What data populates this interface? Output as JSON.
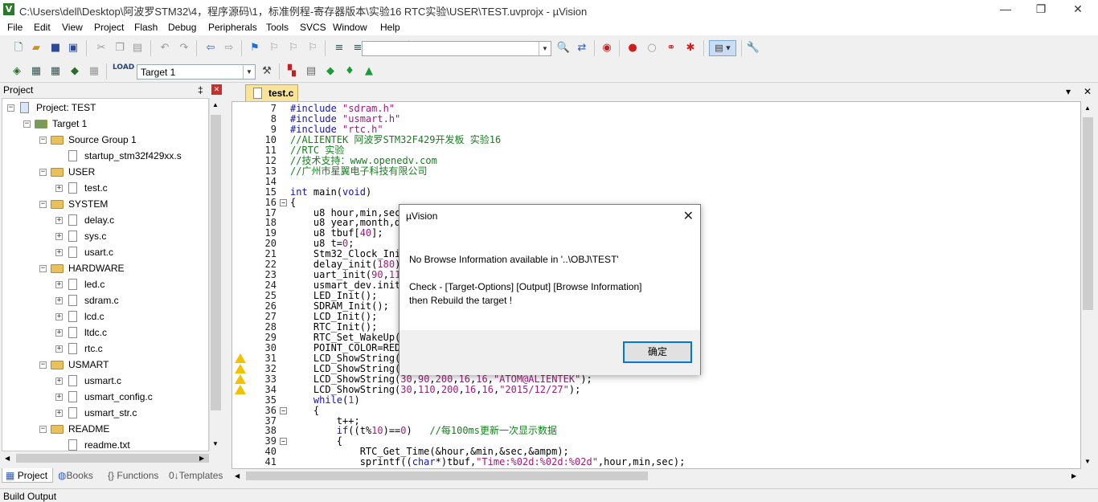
{
  "window": {
    "title": "C:\\Users\\dell\\Desktop\\阿波罗STM32\\4，程序源码\\1，标准例程-寄存器版本\\实验16 RTC实验\\USER\\TEST.uvprojx - µVision",
    "logo": "V",
    "minimize": "—",
    "maximize": "❐",
    "close": "✕"
  },
  "menu": [
    "File",
    "Edit",
    "View",
    "Project",
    "Flash",
    "Debug",
    "Peripherals",
    "Tools",
    "SVCS",
    "Window",
    "Help"
  ],
  "toolbar2": {
    "target": "Target 1"
  },
  "project_panel": {
    "title": "Project",
    "pin": "‡",
    "close": "✕",
    "tree": [
      {
        "label": "Project: TEST",
        "level": 0,
        "kind": "project",
        "box": "−"
      },
      {
        "label": "Target 1",
        "level": 1,
        "kind": "target",
        "box": "−"
      },
      {
        "label": "Source Group 1",
        "level": 2,
        "kind": "folder",
        "box": "−"
      },
      {
        "label": "startup_stm32f429xx.s",
        "level": 3,
        "kind": "file",
        "box": ""
      },
      {
        "label": "USER",
        "level": 2,
        "kind": "folder",
        "box": "−"
      },
      {
        "label": "test.c",
        "level": 3,
        "kind": "file",
        "box": "+"
      },
      {
        "label": "SYSTEM",
        "level": 2,
        "kind": "folder",
        "box": "−"
      },
      {
        "label": "delay.c",
        "level": 3,
        "kind": "file",
        "box": "+"
      },
      {
        "label": "sys.c",
        "level": 3,
        "kind": "file",
        "box": "+"
      },
      {
        "label": "usart.c",
        "level": 3,
        "kind": "file",
        "box": "+"
      },
      {
        "label": "HARDWARE",
        "level": 2,
        "kind": "folder",
        "box": "−"
      },
      {
        "label": "led.c",
        "level": 3,
        "kind": "file",
        "box": "+"
      },
      {
        "label": "sdram.c",
        "level": 3,
        "kind": "file",
        "box": "+"
      },
      {
        "label": "lcd.c",
        "level": 3,
        "kind": "file",
        "box": "+"
      },
      {
        "label": "ltdc.c",
        "level": 3,
        "kind": "file",
        "box": "+"
      },
      {
        "label": "rtc.c",
        "level": 3,
        "kind": "file",
        "box": "+"
      },
      {
        "label": "USMART",
        "level": 2,
        "kind": "folder",
        "box": "−"
      },
      {
        "label": "usmart.c",
        "level": 3,
        "kind": "file",
        "box": "+"
      },
      {
        "label": "usmart_config.c",
        "level": 3,
        "kind": "file",
        "box": "+"
      },
      {
        "label": "usmart_str.c",
        "level": 3,
        "kind": "file",
        "box": "+"
      },
      {
        "label": "README",
        "level": 2,
        "kind": "folder",
        "box": "−"
      },
      {
        "label": "readme.txt",
        "level": 3,
        "kind": "file",
        "box": ""
      }
    ],
    "tabs": [
      "Project",
      "Books",
      "Functions",
      "Templates"
    ]
  },
  "editor": {
    "tab": "test.c",
    "lines": [
      {
        "n": "7",
        "html": "<span class=\"kw\">#include</span> <span class=\"st\">\"sdram.h\"</span>"
      },
      {
        "n": "8",
        "html": "<span class=\"kw\">#include</span> <span class=\"st\">\"usmart.h\"</span>"
      },
      {
        "n": "9",
        "html": "<span class=\"kw\">#include</span> <span class=\"st\">\"rtc.h\"</span>"
      },
      {
        "n": "10",
        "html": "<span class=\"cm\">//ALIENTEK 阿波罗STM32F429开发板 实验16</span>"
      },
      {
        "n": "11",
        "html": "<span class=\"cm\">//RTC 实验</span>"
      },
      {
        "n": "12",
        "html": "<span class=\"cm\">//技术支持：www.openedv.com</span>"
      },
      {
        "n": "13",
        "html": "<span class=\"cm\">//广州市星翼电子科技有限公司</span>"
      },
      {
        "n": "14",
        "html": ""
      },
      {
        "n": "15",
        "html": "<span class=\"kw\">int</span> main(<span class=\"kw\">void</span>)"
      },
      {
        "n": "16",
        "html": "{"
      },
      {
        "n": "17",
        "html": "    u8 hour,min,sec"
      },
      {
        "n": "18",
        "html": "    u8 year,month,d"
      },
      {
        "n": "19",
        "html": "    u8 tbuf[<span class=\"num\">40</span>];"
      },
      {
        "n": "20",
        "html": "    u8 t=<span class=\"num\">0</span>;"
      },
      {
        "n": "21",
        "html": "    Stm32_Clock_Ini"
      },
      {
        "n": "22",
        "html": "    delay_init(<span class=\"num\">180</span>)"
      },
      {
        "n": "23",
        "html": "    uart_init(<span class=\"num\">90</span>,<span class=\"num\">11</span>"
      },
      {
        "n": "24",
        "html": "    usmart_dev.init"
      },
      {
        "n": "25",
        "html": "    LED_Init();"
      },
      {
        "n": "26",
        "html": "    SDRAM_Init();"
      },
      {
        "n": "27",
        "html": "    LCD_Init();"
      },
      {
        "n": "28",
        "html": "    RTC_Init();"
      },
      {
        "n": "29",
        "html": "    RTC_Set_WakeUp("
      },
      {
        "n": "30",
        "html": "    POINT_COLOR=RED"
      },
      {
        "n": "31",
        "html": "    LCD_ShowString("
      },
      {
        "n": "32",
        "html": "    LCD_ShowString("
      },
      {
        "n": "33",
        "html": "    LCD_ShowString(<span class=\"num\">30</span>,<span class=\"num\">90</span>,<span class=\"num\">200</span>,<span class=\"num\">16</span>,<span class=\"num\">16</span>,<span class=\"st\">\"ATOM@ALIENTEK\"</span>);"
      },
      {
        "n": "34",
        "html": "    LCD_ShowString(<span class=\"num\">30</span>,<span class=\"num\">110</span>,<span class=\"num\">200</span>,<span class=\"num\">16</span>,<span class=\"num\">16</span>,<span class=\"st\">\"2015/12/27\"</span>);"
      },
      {
        "n": "35",
        "html": "    <span class=\"kw\">while</span>(<span class=\"num\">1</span>)"
      },
      {
        "n": "36",
        "html": "    {"
      },
      {
        "n": "37",
        "html": "        t++;"
      },
      {
        "n": "38",
        "html": "        <span class=\"kw\">if</span>((t%<span class=\"num\">10</span>)==<span class=\"num\">0</span>)   <span class=\"cm\">//每100ms更新一次显示数据</span>"
      },
      {
        "n": "39",
        "html": "        {"
      },
      {
        "n": "40",
        "html": "            RTC_Get_Time(&amp;hour,&amp;min,&amp;sec,&amp;ampm);"
      },
      {
        "n": "41",
        "html": "            sprintf((<span class=\"kw\">char</span>*)tbuf,<span class=\"st\">\"Time:%02d:%02d:%02d\"</span>,hour,min,sec);"
      }
    ],
    "fold_lines": [
      "16",
      "36",
      "39"
    ],
    "warning_lines": [
      "31",
      "32",
      "33",
      "34"
    ]
  },
  "build_output": {
    "title": "Build Output"
  },
  "dialog": {
    "title": "µVision",
    "close": "✕",
    "message1": "No Browse Information available in '..\\OBJ\\TEST'",
    "message2": "Check - [Target-Options] [Output] [Browse Information]",
    "message3": "then Rebuild the target !",
    "ok": "确定"
  },
  "editor_controls": {
    "dropdown": "▾",
    "close": "✕"
  }
}
